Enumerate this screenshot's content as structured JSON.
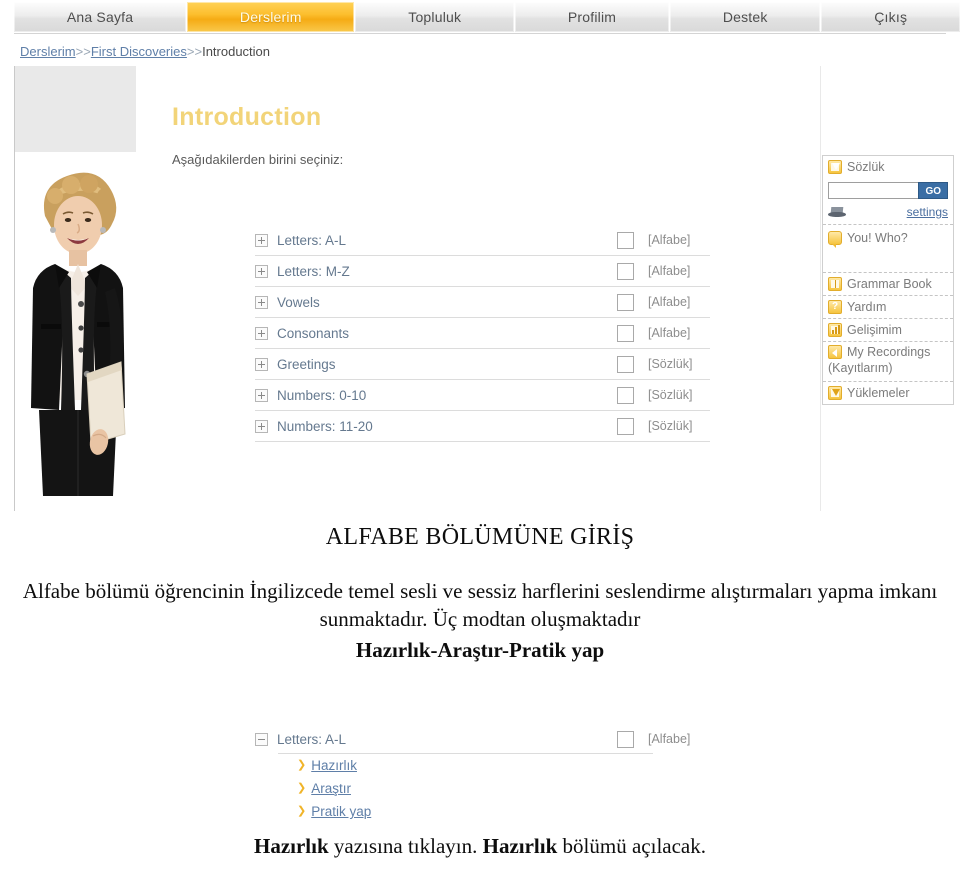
{
  "nav": {
    "tabs": [
      {
        "label": "Ana Sayfa",
        "active": false
      },
      {
        "label": "Derslerim",
        "active": true
      },
      {
        "label": "Topluluk",
        "active": false
      },
      {
        "label": "Profilim",
        "active": false
      },
      {
        "label": "Destek",
        "active": false
      },
      {
        "label": "Çıkış",
        "active": false
      }
    ]
  },
  "breadcrumb": {
    "item1": "Derslerim",
    "sep1": ">>",
    "item2": "First Discoveries",
    "sep2": ">>",
    "item3": "Introduction"
  },
  "page": {
    "title": "Introduction",
    "choose_label": "Aşağıdakilerden birini seçiniz:"
  },
  "lessons": [
    {
      "name": "Letters: A-L",
      "tag": "[Alfabe]"
    },
    {
      "name": "Letters: M-Z",
      "tag": "[Alfabe]"
    },
    {
      "name": "Vowels",
      "tag": "[Alfabe]"
    },
    {
      "name": "Consonants",
      "tag": "[Alfabe]"
    },
    {
      "name": "Greetings",
      "tag": "[Sözlük]"
    },
    {
      "name": "Numbers: 0-10",
      "tag": "[Sözlük]"
    },
    {
      "name": "Numbers: 11-20",
      "tag": "[Sözlük]"
    }
  ],
  "sidebar": {
    "dictionary_label": "Sözlük",
    "search_value": "",
    "search_placeholder": "",
    "go_label": "GO",
    "settings_label": "settings",
    "items": [
      {
        "label": "You! Who?"
      },
      {
        "label": "Grammar Book"
      },
      {
        "label": "Yardım"
      },
      {
        "label": "Gelişimim"
      },
      {
        "label": "My Recordings",
        "label2": "(Kayıtlarım)"
      },
      {
        "label": "Yüklemeler"
      }
    ]
  },
  "document": {
    "heading": "ALFABE BÖLÜMÜNE GİRİŞ",
    "paragraph": "Alfabe bölümü öğrencinin İngilizcede temel sesli ve sessiz harflerini seslendirme alıştırmaları yapma imkanı sunmaktadır. Üç modtan oluşmaktadır",
    "modes": "Hazırlık-Araştır-Pratik yap",
    "footer_bold1": "Hazırlık",
    "footer_mid": " yazısına tıklayın. ",
    "footer_bold2": "Hazırlık",
    "footer_end": " bölümü açılacak."
  },
  "fragment": {
    "expanded_lesson": {
      "name": "Letters: A-L",
      "tag": "[Alfabe]"
    },
    "sub_links": [
      {
        "label": "Hazırlık"
      },
      {
        "label": "Araştır"
      },
      {
        "label": "Pratik yap"
      }
    ]
  },
  "colors": {
    "accent_orange": "#f5ab14",
    "title_gold": "#f2d479",
    "link_blue": "#5f7fa8",
    "go_blue": "#3a6ea5"
  }
}
